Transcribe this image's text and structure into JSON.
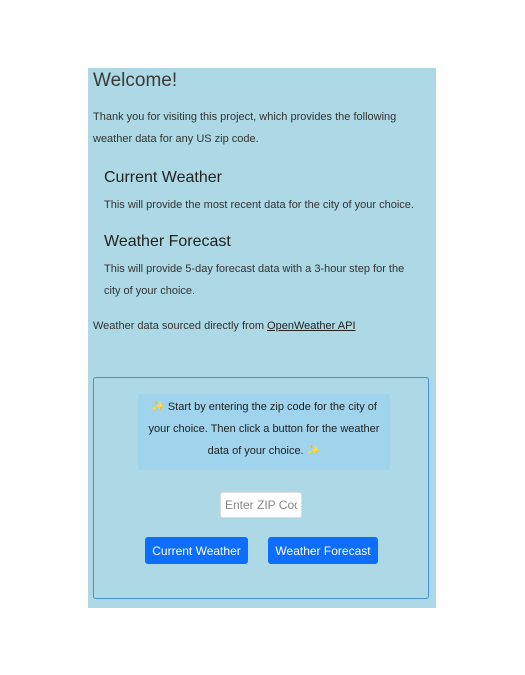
{
  "welcome": {
    "title": "Welcome!"
  },
  "intro": {
    "text": "Thank you for visiting this project, which provides the following weather data for any US zip code."
  },
  "sections": [
    {
      "title": "Current Weather",
      "description": "This will provide the most recent data for the city of your choice."
    },
    {
      "title": "Weather Forecast",
      "description": "This will provide 5-day forecast data with a 3-hour step for the city of your choice."
    }
  ],
  "source": {
    "prefix": "Weather data sourced directly from ",
    "link_text": "OpenWeather API"
  },
  "card": {
    "hint_text": "Start by entering the zip code for the city of your choice. Then click a button for the weather data of your choice.",
    "hint_icon": "✨",
    "zip_placeholder": "Enter ZIP Code",
    "current_button": "Current Weather",
    "forecast_button": "Weather Forecast"
  },
  "colors": {
    "panel_bg": "#add8e6",
    "button_bg": "#0d6efd",
    "hint_bg": "#9fd4ec"
  }
}
